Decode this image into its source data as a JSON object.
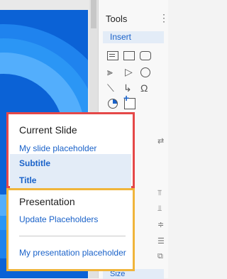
{
  "tools_pane": {
    "title": "Tools",
    "menu_icon": "more-vertical-icon",
    "insert_tab": "Insert",
    "size_tab": "Size"
  },
  "insert_shapes": [
    "text-box-icon",
    "rectangle-icon",
    "rounded-rectangle-icon",
    "chevron-icon",
    "triangle-icon",
    "oval-icon",
    "line-icon",
    "connector-icon",
    "omega-icon",
    "pie-icon",
    "placeholder-add-icon"
  ],
  "current_slide_menu": {
    "heading": "Current Slide",
    "items": [
      "My slide placeholder",
      "Subtitle",
      "Title"
    ]
  },
  "presentation_menu": {
    "heading": "Presentation",
    "items": [
      "Update Placeholders",
      "My presentation placeholder"
    ]
  },
  "colors": {
    "accent": "#1a62c9",
    "red_outline": "#e54848",
    "orange_outline": "#f0b53b",
    "slide_blue": "#0b62d6"
  }
}
